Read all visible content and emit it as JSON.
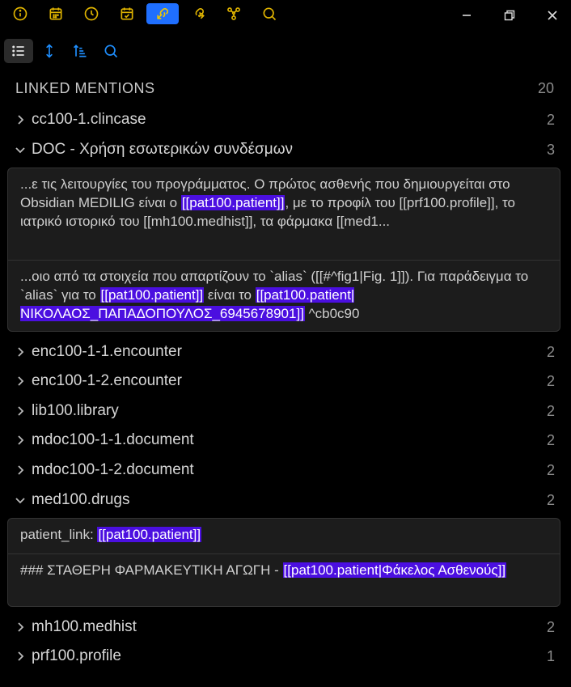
{
  "toolbar": {
    "icons": [
      "info-icon",
      "calendar-icon",
      "clock-icon",
      "calendar-check-icon",
      "backlinks-icon",
      "outgoing-links-icon",
      "graph-icon",
      "search-icon"
    ],
    "active_icon": "backlinks-icon",
    "accent": "#1f6fff"
  },
  "subtoolbar": {
    "icons": [
      "list-icon",
      "expand-collapse-icon",
      "sort-icon",
      "search-icon"
    ]
  },
  "linked_mentions": {
    "title": "LINKED MENTIONS",
    "count": "20"
  },
  "files": [
    {
      "name": "cc100-1.clincase",
      "count": "2"
    },
    {
      "name": "DOC - Χρήση εσωτερικών συνδέσμων",
      "count": "3"
    },
    {
      "name": "enc100-1-1.encounter",
      "count": "2"
    },
    {
      "name": "enc100-1-2.encounter",
      "count": "2"
    },
    {
      "name": "lib100.library",
      "count": "2"
    },
    {
      "name": "mdoc100-1-1.document",
      "count": "2"
    },
    {
      "name": "mdoc100-1-2.document",
      "count": "2"
    },
    {
      "name": "med100.drugs",
      "count": "2"
    },
    {
      "name": "mh100.medhist",
      "count": "2"
    },
    {
      "name": "prf100.profile",
      "count": "1"
    }
  ],
  "doc_matches": {
    "m1_pre": "...ε τις λειτουργίες του προγράμματος. Ο πρώτος ασθενής που δημιουργείται στο Obsidian MEDILIG είναι ο ",
    "m1_hl": "[[pat100.patient]]",
    "m1_post": ", με το προφίλ του  [[prf100.profile]], το ιατρικό ιστορικό του [[mh100.medhist]], τα φάρμακα [[med1...",
    "m2_pre": "...οιο από τα στοιχεία που απαρτίζουν το `alias` ([[#^fig1|Fig. 1]]). Για παράδειγμα το `alias` για το ",
    "m2_hl1": "[[pat100.patient]]",
    "m2_mid": " είναι το ",
    "m2_hl2": "[[pat100.patient|ΝΙΚΟΛΑΟΣ_ΠΑΠΑΔΟΠΟΥΛΟΣ_6945678901]]",
    "m2_post": " ^cb0c90"
  },
  "drugs_matches": {
    "m1_pre": "patient_link: ",
    "m1_hl": "[[pat100.patient]]",
    "m2_pre": "### ΣΤΑΘΕΡΗ ΦΑΡΜΑΚΕΥΤΙΚΗ ΑΓΩΓΗ - ",
    "m2_hl": "[[pat100.patient|Φάκελος Ασθενούς]]"
  },
  "colors": {
    "highlight": "#4b0fe0",
    "background": "#000000",
    "panel": "#1c1c1c"
  }
}
